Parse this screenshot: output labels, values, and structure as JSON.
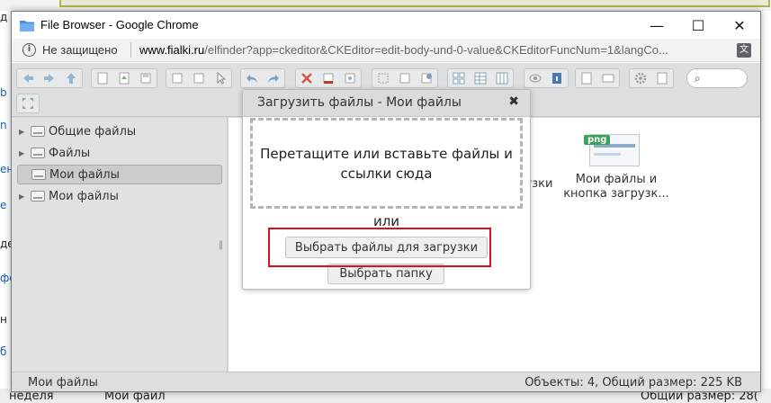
{
  "window": {
    "title": "File Browser - Google Chrome",
    "minimize": "—",
    "maximize": "☐",
    "close": "✕"
  },
  "addressbar": {
    "security_label": "Не защищено",
    "url_host": "www.fialki.ru",
    "url_rest": "/elfinder?app=ckeditor&CKEditor=edit-body-und-0-value&CKEditorFuncNum=1&langCo..."
  },
  "navbar": {
    "items": [
      {
        "label": "Общие файлы"
      },
      {
        "label": "Файлы"
      },
      {
        "label": "Мои файлы"
      },
      {
        "label": "Мои файлы"
      }
    ]
  },
  "files": {
    "partial_label_1": "узки",
    "partial_label_2": "",
    "png_badge": "png",
    "file_name_line1": "Мои файлы и",
    "file_name_line2": "кнопка загрузк..."
  },
  "statusbar": {
    "current_folder": "Мои файлы",
    "summary": "Объекты: 4, Общий размер: 225 KB"
  },
  "dialog": {
    "title": "Загрузить файлы - Мои файлы",
    "close": "✖",
    "dropzone_text": "Перетащите или вставьте файлы и ссылки сюда",
    "or_text": "или",
    "select_files_button": "Выбрать файлы для загрузки",
    "select_folder_button": "Выбрать папку"
  },
  "background": {
    "frag_1": "д",
    "frag_2": "b",
    "frag_3": "n",
    "frag_4": "ен",
    "frag_5": "е з",
    "frag_6": "де",
    "frag_7": "фо",
    "frag_8": "н",
    "frag_9": "б",
    "bottom_1": "неделя",
    "bottom_2": "Мои файл",
    "bottom_3": "Общий размер: 28("
  },
  "colors": {
    "highlight": "#d8121b",
    "png_badge": "#3aa35a"
  }
}
